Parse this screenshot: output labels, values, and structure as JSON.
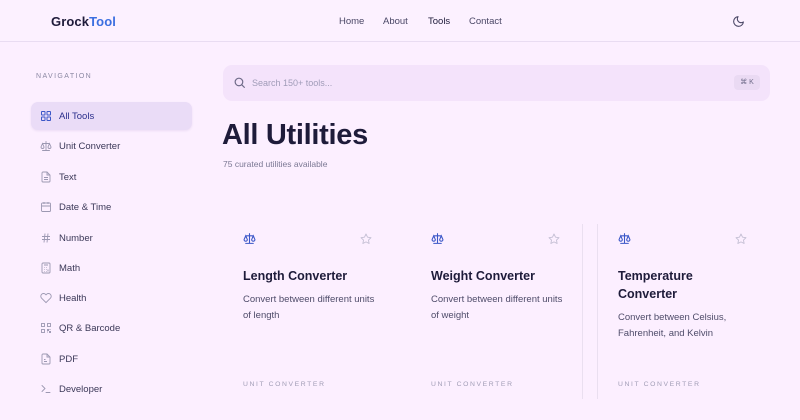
{
  "header": {
    "logo_part1": "Grock",
    "logo_part2": "Tool",
    "nav": [
      {
        "label": "Home",
        "active": false
      },
      {
        "label": "About",
        "active": false
      },
      {
        "label": "Tools",
        "active": true
      },
      {
        "label": "Contact",
        "active": false
      }
    ],
    "theme_icon": "moon-icon"
  },
  "sidebar": {
    "heading": "NAVIGATION",
    "items": [
      {
        "label": "All Tools",
        "icon": "grid-icon",
        "active": true
      },
      {
        "label": "Unit Converter",
        "icon": "scale-icon",
        "active": false
      },
      {
        "label": "Text",
        "icon": "document-icon",
        "active": false
      },
      {
        "label": "Date & Time",
        "icon": "calendar-icon",
        "active": false
      },
      {
        "label": "Number",
        "icon": "hash-icon",
        "active": false
      },
      {
        "label": "Math",
        "icon": "calculator-icon",
        "active": false
      },
      {
        "label": "Health",
        "icon": "heart-icon",
        "active": false
      },
      {
        "label": "QR & Barcode",
        "icon": "qr-code-icon",
        "active": false
      },
      {
        "label": "PDF",
        "icon": "pdf-file-icon",
        "active": false
      },
      {
        "label": "Developer",
        "icon": "terminal-icon",
        "active": false
      }
    ]
  },
  "search": {
    "placeholder": "Search 150+ tools...",
    "value": "",
    "shortcut": "⌘ K"
  },
  "main": {
    "title": "All Utilities",
    "subtitle": "75 curated utilities available",
    "cards": [
      {
        "title": "Length Converter",
        "description": "Convert between different units of length",
        "category": "UNIT CONVERTER",
        "icon": "scale-icon"
      },
      {
        "title": "Weight Converter",
        "description": "Convert between different units of weight",
        "category": "UNIT CONVERTER",
        "icon": "scale-icon"
      },
      {
        "title": "Temperature Converter",
        "description": "Convert between Celsius, Fahrenheit, and Kelvin",
        "category": "UNIT CONVERTER",
        "icon": "scale-icon"
      }
    ]
  },
  "colors": {
    "background": "#fcefff",
    "accent": "#3b6fe0",
    "sidebar_active": "#eadcf7",
    "text_dark": "#1e1b3a"
  }
}
